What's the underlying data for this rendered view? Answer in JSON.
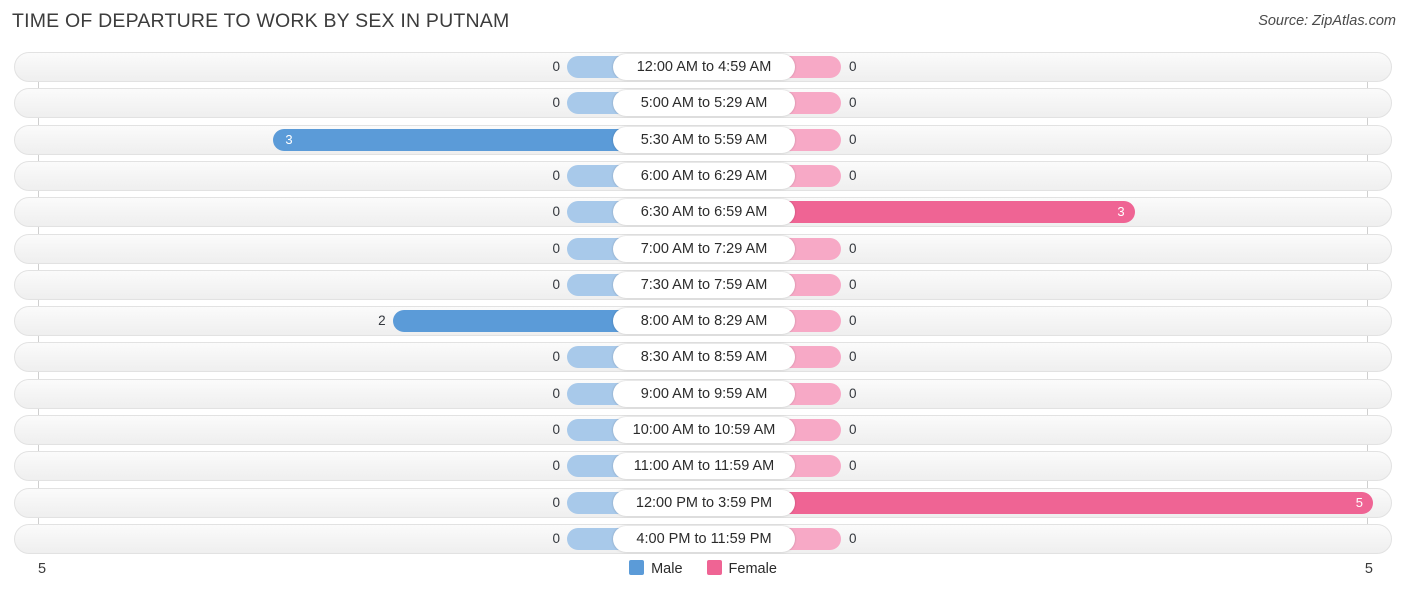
{
  "header": {
    "title": "TIME OF DEPARTURE TO WORK BY SEX IN PUTNAM",
    "source": "Source: ZipAtlas.com"
  },
  "axis": {
    "left_tick": "5",
    "right_tick": "5",
    "max": 5
  },
  "legend": {
    "items": [
      {
        "label": "Male",
        "color": "#5b9bd8"
      },
      {
        "label": "Female",
        "color": "#ef6494"
      }
    ]
  },
  "colors": {
    "male": "#5b9bd8",
    "male_zero": "#a8c9ea",
    "female": "#ef6494",
    "female_zero": "#f7a9c6",
    "row_border": "#e2e2e2",
    "axis_line": "#cfcfcf",
    "title": "#3c3c3c"
  },
  "chart_data": {
    "type": "bar",
    "title": "TIME OF DEPARTURE TO WORK BY SEX IN PUTNAM",
    "subtitle": "",
    "xlabel": "",
    "ylabel": "",
    "orientation": "horizontal-diverging",
    "grid": false,
    "legend_position": "bottom-center",
    "xlim": [
      0,
      5
    ],
    "categories": [
      "12:00 AM to 4:59 AM",
      "5:00 AM to 5:29 AM",
      "5:30 AM to 5:59 AM",
      "6:00 AM to 6:29 AM",
      "6:30 AM to 6:59 AM",
      "7:00 AM to 7:29 AM",
      "7:30 AM to 7:59 AM",
      "8:00 AM to 8:29 AM",
      "8:30 AM to 8:59 AM",
      "9:00 AM to 9:59 AM",
      "10:00 AM to 10:59 AM",
      "11:00 AM to 11:59 AM",
      "12:00 PM to 3:59 PM",
      "4:00 PM to 11:59 PM"
    ],
    "series": [
      {
        "name": "Male",
        "color": "#5b9bd8",
        "side": "left",
        "values": [
          0,
          0,
          3,
          0,
          0,
          0,
          0,
          2,
          0,
          0,
          0,
          0,
          0,
          0
        ]
      },
      {
        "name": "Female",
        "color": "#ef6494",
        "side": "right",
        "values": [
          0,
          0,
          0,
          0,
          3,
          0,
          0,
          0,
          0,
          0,
          0,
          0,
          5,
          0
        ]
      }
    ]
  },
  "rows": [
    {
      "label": "12:00 AM to 4:59 AM",
      "male": "0",
      "female": "0"
    },
    {
      "label": "5:00 AM to 5:29 AM",
      "male": "0",
      "female": "0"
    },
    {
      "label": "5:30 AM to 5:59 AM",
      "male": "3",
      "female": "0"
    },
    {
      "label": "6:00 AM to 6:29 AM",
      "male": "0",
      "female": "0"
    },
    {
      "label": "6:30 AM to 6:59 AM",
      "male": "0",
      "female": "3"
    },
    {
      "label": "7:00 AM to 7:29 AM",
      "male": "0",
      "female": "0"
    },
    {
      "label": "7:30 AM to 7:59 AM",
      "male": "0",
      "female": "0"
    },
    {
      "label": "8:00 AM to 8:29 AM",
      "male": "2",
      "female": "0"
    },
    {
      "label": "8:30 AM to 8:59 AM",
      "male": "0",
      "female": "0"
    },
    {
      "label": "9:00 AM to 9:59 AM",
      "male": "0",
      "female": "0"
    },
    {
      "label": "10:00 AM to 10:59 AM",
      "male": "0",
      "female": "0"
    },
    {
      "label": "11:00 AM to 11:59 AM",
      "male": "0",
      "female": "0"
    },
    {
      "label": "12:00 PM to 3:59 PM",
      "male": "0",
      "female": "5"
    },
    {
      "label": "4:00 PM to 11:59 PM",
      "male": "0",
      "female": "0"
    }
  ]
}
